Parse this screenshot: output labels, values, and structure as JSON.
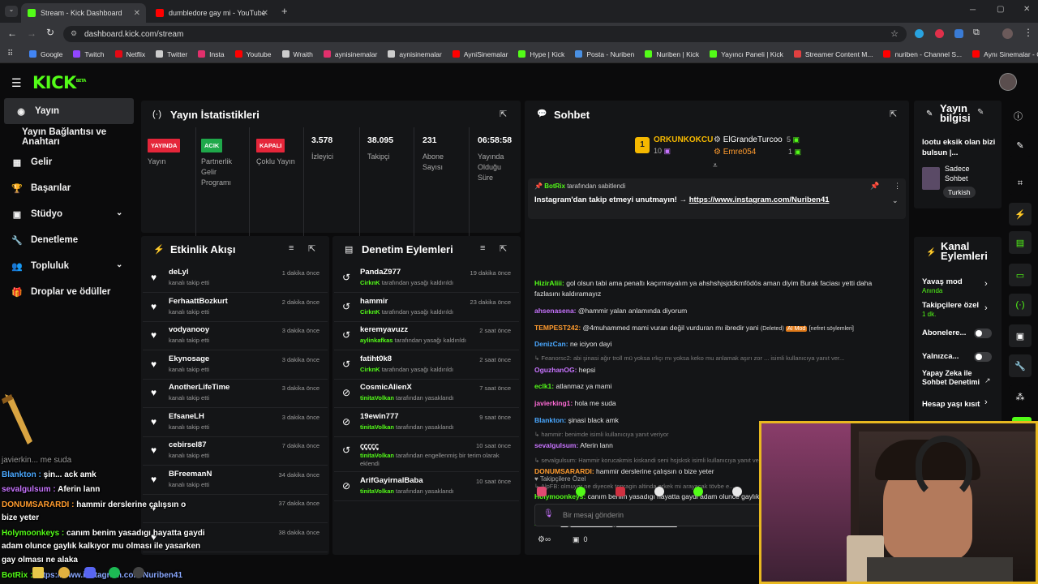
{
  "browser": {
    "tabs": [
      {
        "label": "Stream - Kick Dashboard"
      },
      {
        "label": "dumbledore gay mi - YouTube"
      }
    ],
    "url": "dashboard.kick.com/stream",
    "bookmarks": [
      {
        "label": "Google",
        "color": "#4285f4"
      },
      {
        "label": "Twitch",
        "color": "#9146ff"
      },
      {
        "label": "Netflix",
        "color": "#e50914"
      },
      {
        "label": "Twitter",
        "color": "#cccccc"
      },
      {
        "label": "Insta",
        "color": "#e1306c"
      },
      {
        "label": "Youtube",
        "color": "#ff0000"
      },
      {
        "label": "Wraith",
        "color": "#cccccc"
      },
      {
        "label": "aynisinemalar",
        "color": "#e1306c"
      },
      {
        "label": "aynisinemalar",
        "color": "#cccccc"
      },
      {
        "label": "AyniSinemalar",
        "color": "#ff0000"
      },
      {
        "label": "Hype | Kick",
        "color": "#53fc18"
      },
      {
        "label": "Posta - Nuriben",
        "color": "#4a90e2"
      },
      {
        "label": "Nuriben | Kick",
        "color": "#53fc18"
      },
      {
        "label": "Yayıncı Paneli | Kick",
        "color": "#53fc18"
      },
      {
        "label": "Streamer Content M...",
        "color": "#e04040"
      },
      {
        "label": "nuriben - Channel S...",
        "color": "#ff0000"
      },
      {
        "label": "Aynı Sinemalar - Ça...",
        "color": "#ff0000"
      }
    ]
  },
  "brand": {
    "logo": "KICK",
    "beta": "BETA",
    "accent": "#53fc18"
  },
  "sidebar": {
    "items": [
      {
        "label": "Yayın",
        "icon": "broadcast-icon"
      },
      {
        "label": "Yayın Bağlantısı ve Anahtarı",
        "icon": ""
      },
      {
        "label": "Gelir",
        "icon": "chart-icon"
      },
      {
        "label": "Başarılar",
        "icon": "trophy-icon"
      },
      {
        "label": "Stüdyo",
        "icon": "studio-icon"
      },
      {
        "label": "Denetleme",
        "icon": "wrench-icon"
      },
      {
        "label": "Topluluk",
        "icon": "community-icon"
      },
      {
        "label": "Droplar ve ödüller",
        "icon": "gift-icon"
      }
    ]
  },
  "stats": {
    "title": "Yayın İstatistikleri",
    "items": [
      {
        "badge": "YAYINDA",
        "badge_color": "#e5263a",
        "label": "Yayın"
      },
      {
        "badge": "ACIK",
        "badge_color": "#1fa84a",
        "label": "Partnerlik Gelir Programı"
      },
      {
        "badge": "KAPALI",
        "badge_color": "#e5263a",
        "label": "Çoklu Yayın"
      },
      {
        "value": "3.578",
        "label": "İzleyici"
      },
      {
        "value": "38.095",
        "label": "Takipçi"
      },
      {
        "value": "231",
        "label": "Abone Sayısı"
      },
      {
        "value": "06:58:58",
        "label": "Yayında Olduğu Süre"
      }
    ]
  },
  "activity": {
    "title": "Etkinlik Akışı",
    "rows": [
      {
        "name": "deLyl",
        "sub": "kanalı takip etti",
        "time": "1 dakika önce"
      },
      {
        "name": "FerhaattBozkurt",
        "sub": "kanalı takip etti",
        "time": "2 dakika önce"
      },
      {
        "name": "vodyanooy",
        "sub": "kanalı takip etti",
        "time": "3 dakika önce"
      },
      {
        "name": "Ekynosage",
        "sub": "kanalı takip etti",
        "time": "3 dakika önce"
      },
      {
        "name": "AnotherLifeTime",
        "sub": "kanalı takip etti",
        "time": "3 dakika önce"
      },
      {
        "name": "EfsaneLH",
        "sub": "kanalı takip etti",
        "time": "3 dakika önce"
      },
      {
        "name": "cebirsel87",
        "sub": "kanalı takip etti",
        "time": "7 dakika önce"
      },
      {
        "name": "BFreemanN",
        "sub": "kanalı takip etti",
        "time": "34 dakika önce"
      },
      {
        "name": "",
        "sub": "",
        "time": "37 dakika önce"
      },
      {
        "name": "",
        "sub": "",
        "time": "38 dakika önce"
      }
    ]
  },
  "moderation": {
    "title": "Denetim Eylemleri",
    "rows": [
      {
        "name": "PandaZ977",
        "actor": "CirknK",
        "action": "tarafından yasağı kaldırıldı",
        "time": "19 dakika önce",
        "icon": "undo-icon"
      },
      {
        "name": "hammir",
        "actor": "CirknK",
        "action": "tarafından yasağı kaldırıldı",
        "time": "23 dakika önce",
        "icon": "undo-icon"
      },
      {
        "name": "keremyavuzz",
        "actor": "aylinkafkas",
        "action": "tarafından yasağı kaldırıldı",
        "time": "2 saat önce",
        "icon": "undo-icon"
      },
      {
        "name": "fatiht0k8",
        "actor": "CirknK",
        "action": "tarafından yasağı kaldırıldı",
        "time": "2 saat önce",
        "icon": "undo-icon"
      },
      {
        "name": "CosmicAlienX",
        "actor": "tinitaVolkan",
        "action": "tarafından yasaklandı",
        "time": "7 saat önce",
        "icon": "ban-icon"
      },
      {
        "name": "19ewin777",
        "actor": "tinitaVolkan",
        "action": "tarafından yasaklandı",
        "time": "9 saat önce",
        "icon": "ban-icon"
      },
      {
        "name": "ꞔꞔꞔꞔꞔ",
        "actor": "tinitaVolkan",
        "action": "tarafından engellenmiş bir terim olarak eklendi",
        "time": "10 saat önce",
        "icon": "undo-icon"
      },
      {
        "name": "ArifGayirnalBaba",
        "actor": "tinitaVolkan",
        "action": "tarafından yasaklandı",
        "time": "10 saat önce",
        "icon": "ban-icon"
      }
    ]
  },
  "chat": {
    "title": "Sohbet",
    "leaderboard": [
      {
        "rank": "1",
        "name": "ORKUNKOKCU",
        "count": "10"
      },
      {
        "name": "ElGrandeTurcoo",
        "count": "5"
      },
      {
        "name": "Emre054",
        "count": "1"
      }
    ],
    "pinned": {
      "by": "BotRix",
      "by_suffix": "tarafından sabitlendi",
      "text": "Instagram'dan takip etmeyi unutmayın! →",
      "link": "https://www.instagram.com/Nuriben41"
    },
    "messages": [
      {
        "user": "HizirAliii:",
        "color": "#53fc18",
        "text": "gol olsun tabi ama penaltı kaçırmayalım ya ahshshjsjddkmfödös aman diyim Burak faciası yetti daha",
        "text2": "fazlasını kaldıramayız"
      },
      {
        "user": "ahsenasena:",
        "color": "#c874ff",
        "text": "@hammir yalan anlamında diyorum"
      },
      {
        "user": "TEMPEST242:",
        "color": "#ff9b2e",
        "text": "@4muhammed mami vuran değil vurduran mı ibredir yani",
        "deleted": "(Deleted)",
        "tag": "AI Mod",
        "tag2": "[nefret söylemleri]"
      },
      {
        "user": "DenizCan:",
        "color": "#4aa8ff",
        "text": "ne iciyon dayi"
      },
      {
        "reply": "↳ Feanorsc2: abi şinasi ağır troll mü yoksa ırkçı mı yoksa keko mu anlamak aşırı zor ... isimli kullanıcıya yanıt ver..."
      },
      {
        "user": "OguzhanOG:",
        "color": "#c874ff",
        "text": "hepsi"
      },
      {
        "user": "eclk1:",
        "color": "#53fc18",
        "text": "atlanmaz ya mami"
      },
      {
        "user": "javierking1:",
        "color": "#ff6bd6",
        "text": "hola me suda"
      },
      {
        "user": "Blankton:",
        "color": "#4aa8ff",
        "text": "şinasi black amk"
      },
      {
        "reply": "↳ hammir: benimde isimli kullanıcıya yanıt veriyor"
      },
      {
        "user": "sevalgulsum:",
        "color": "#c874ff",
        "text": "Aferin lann"
      },
      {
        "reply": "↳ sevalgulsum: Hammir korucakmis kiskandi seni hsjsksk isimli kullanıcıya yanıt veriyor"
      },
      {
        "user": "DONUMSARARDI:",
        "color": "#ff9b2e",
        "text": "hammir derslerine çalışsın o bize yeter"
      },
      {
        "reply": "↳ AlpFB: olmuyor ne diyecek topragin altinda erkek mi arayacak tövbe e..."
      },
      {
        "user": "Holymoonkeys:",
        "color": "#53fc18",
        "text": "canım benim yasadıgı hayatta gaydi adam olunce gaylık kal...",
        "text2": "olması ne alaka"
      },
      {
        "user": "BotRix:",
        "color": "#53fc18",
        "text": "https://www.instagram.com/Nuriben41"
      }
    ],
    "followers_only": "Takipçilere Özel",
    "input_placeholder": "Bir mesaj gönderin",
    "footer_count": "0"
  },
  "stream_info": {
    "title": "Yayın bilgisi",
    "stream_title": "lootu eksik olan bizi bulsun |...",
    "tag_label": "Sadece Sohbet",
    "language": "Turkish"
  },
  "channel_actions": {
    "title": "Kanal Eylemleri",
    "items": [
      {
        "label": "Yavaş mod",
        "sub": "Anında",
        "control": "chevron"
      },
      {
        "label": "Takipçilere özel",
        "sub": "1 dk.",
        "control": "chevron"
      },
      {
        "label": "Abonelere...",
        "control": "toggle"
      },
      {
        "label": "Yalnızca...",
        "control": "toggle"
      },
      {
        "label": "Yapay Zeka ile Sohbet Denetimi",
        "control": "external"
      },
      {
        "label": "Hesap yaşı kısıt",
        "control": "chevron"
      }
    ]
  },
  "overlay": {
    "lines": [
      {
        "text": "javierkin...          me suda",
        "color": "#9a9a9a"
      },
      {
        "user": "Blankton :",
        "color": "#4aa8ff",
        "text": "şin...    ack amk"
      },
      {
        "user": "sevalgulsum :",
        "color": "#c874ff",
        "text": "Aferin lann"
      },
      {
        "user": "DONUMSARARDI :",
        "color": "#ff9b2e",
        "text": "hammir derslerine çalışsın o"
      },
      {
        "text": "bize yeter",
        "color": "#ffffff"
      },
      {
        "user": "Holymoonkeys :",
        "color": "#53fc18",
        "text": "canım benim yasadıgı hayatta gaydi"
      },
      {
        "text": "adam olunce gaylık kalkıyor mu olması ile yasarken",
        "color": "#ffffff"
      },
      {
        "text": "gay olması ne alaka",
        "color": "#ffffff"
      },
      {
        "user": "BotRix :",
        "color": "#53fc18",
        "text": "https://www.instagram.com/Nuriben41"
      }
    ]
  }
}
